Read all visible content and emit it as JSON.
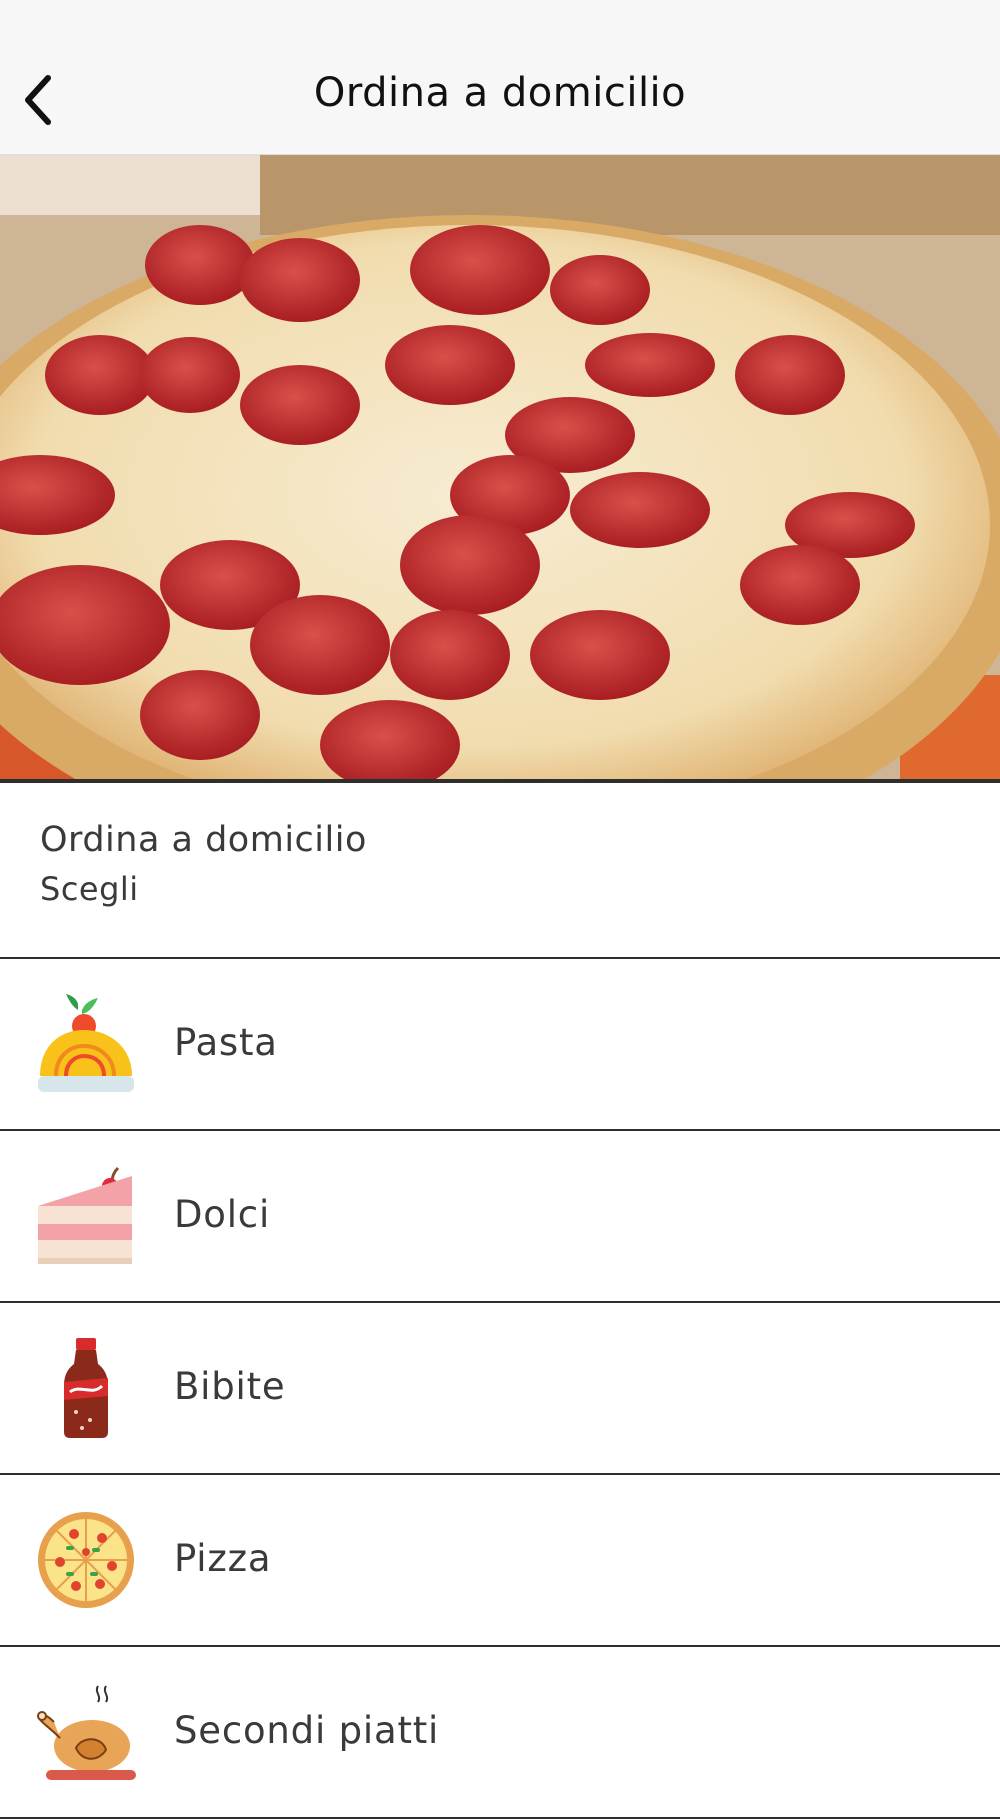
{
  "header": {
    "title": "Ordina a domicilio",
    "back_icon": "chevron-left-icon"
  },
  "hero": {
    "image": "pepperoni-pizza-photo"
  },
  "intro": {
    "title": "Ordina a domicilio",
    "subtitle": "Scegli"
  },
  "categories": [
    {
      "label": "Pasta",
      "icon": "pasta-icon"
    },
    {
      "label": "Dolci",
      "icon": "cake-icon"
    },
    {
      "label": "Bibite",
      "icon": "soda-bottle-icon"
    },
    {
      "label": "Pizza",
      "icon": "pizza-icon"
    },
    {
      "label": "Secondi piatti",
      "icon": "roast-chicken-icon"
    }
  ]
}
